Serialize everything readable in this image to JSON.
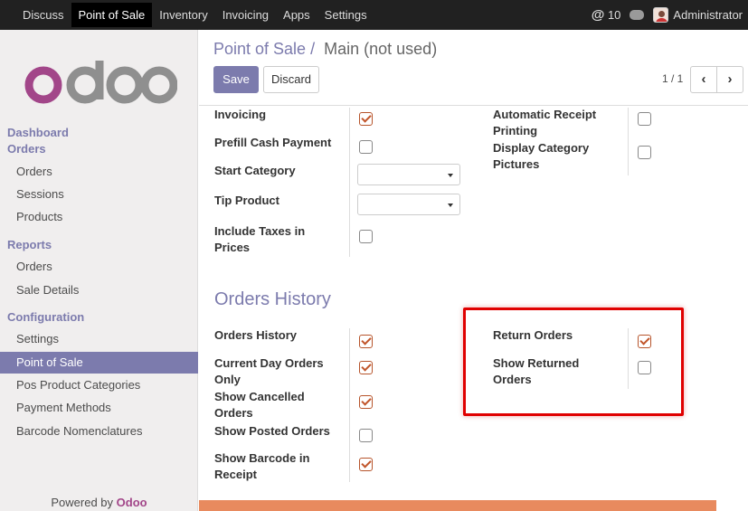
{
  "topbar": {
    "menu": [
      "Discuss",
      "Point of Sale",
      "Inventory",
      "Invoicing",
      "Apps",
      "Settings"
    ],
    "active_index": 1,
    "notifications_count": "10",
    "user": "Administrator"
  },
  "sidebar": {
    "logo_text": "odoo",
    "sections": [
      {
        "title": "Dashboard"
      },
      {
        "title": "Orders",
        "items": [
          "Orders",
          "Sessions",
          "Products"
        ]
      },
      {
        "title": "Reports",
        "items": [
          "Orders",
          "Sale Details"
        ]
      },
      {
        "title": "Configuration",
        "items": [
          "Settings",
          "Point of Sale",
          "Pos Product Categories",
          "Payment Methods",
          "Barcode Nomenclatures"
        ]
      }
    ],
    "active_item": "Point of Sale",
    "powered_by": "Powered by",
    "powered_brand": "Odoo"
  },
  "breadcrumb": {
    "parent": "Point of Sale",
    "separator": "/",
    "current": "Main (not used)"
  },
  "toolbar": {
    "save_label": "Save",
    "discard_label": "Discard"
  },
  "pager": {
    "text": "1 / 1",
    "prev": "‹",
    "next": "›"
  },
  "form": {
    "left_fields": [
      {
        "label": "Invoicing",
        "type": "checkbox",
        "checked": true
      },
      {
        "label": "Prefill Cash Payment",
        "type": "checkbox",
        "checked": false
      },
      {
        "label": "Start Category",
        "type": "select",
        "value": ""
      },
      {
        "label": "Tip Product",
        "type": "select",
        "value": ""
      },
      {
        "label": "Include Taxes in Prices",
        "type": "checkbox",
        "checked": false
      }
    ],
    "right_fields": [
      {
        "label": "Automatic Receipt Printing",
        "type": "checkbox",
        "checked": false
      },
      {
        "label": "Display Category Pictures",
        "type": "checkbox",
        "checked": false
      }
    ]
  },
  "orders_history": {
    "title": "Orders History",
    "left_fields": [
      {
        "label": "Orders History",
        "checked": true
      },
      {
        "label": "Current Day Orders Only",
        "checked": true
      },
      {
        "label": "Show Cancelled Orders",
        "checked": true
      },
      {
        "label": "Show Posted Orders",
        "checked": false
      },
      {
        "label": "Show Barcode in Receipt",
        "checked": true
      }
    ],
    "right_fields": [
      {
        "label": "Return Orders",
        "checked": true
      },
      {
        "label": "Show Returned Orders",
        "checked": false
      }
    ]
  },
  "colors": {
    "accent": "#7c7bad",
    "highlight": "#e00000",
    "checkbox": "#c1552a",
    "topbar": "#212121"
  }
}
